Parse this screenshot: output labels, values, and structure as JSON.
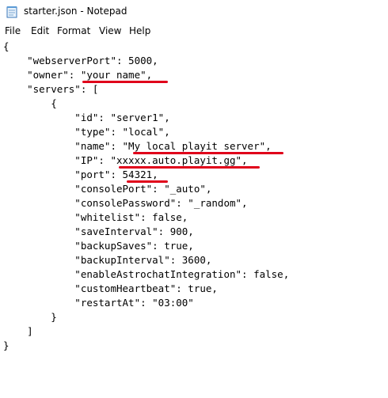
{
  "window": {
    "title": "starter.json - Notepad",
    "app_icon": "notepad-icon"
  },
  "menu": {
    "items": [
      "File",
      "Edit",
      "Format",
      "View",
      "Help"
    ]
  },
  "editor": {
    "lines": [
      "{",
      "    \"webserverPort\": 5000,",
      "    \"owner\": \"your name\",",
      "    \"servers\": [",
      "        {",
      "            \"id\": \"server1\",",
      "            \"type\": \"local\",",
      "            \"name\": \"My local playit server\",",
      "            \"IP\": \"xxxxx.auto.playit.gg\",",
      "            \"port\": 54321,",
      "            \"consolePort\": \"_auto\",",
      "            \"consolePassword\": \"_random\",",
      "            \"whitelist\": false,",
      "            \"saveInterval\": 900,",
      "            \"backupSaves\": true,",
      "            \"backupInterval\": 3600,",
      "            \"enableAstrochatIntegration\": false,",
      "            \"customHeartbeat\": true,",
      "            \"restartAt\": \"03:00\"",
      "        }",
      "    ]",
      "}"
    ],
    "annotation_color": "#e0001a"
  }
}
